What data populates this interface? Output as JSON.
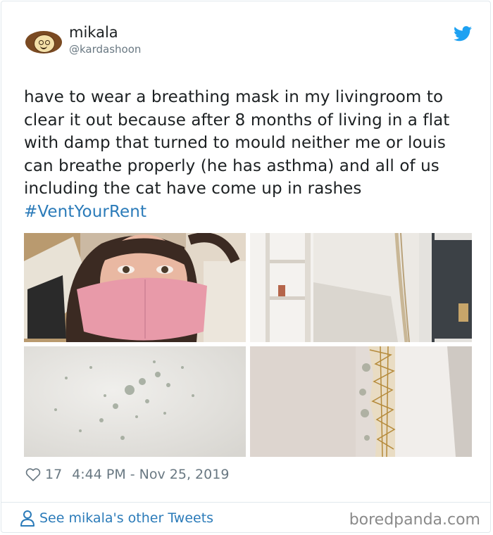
{
  "user": {
    "name": "mikala",
    "handle": "@kardashoon",
    "avatar": "cartoon-face-avatar"
  },
  "tweet": {
    "text": "have to wear a breathing mask in my livingroom to clear it out because after 8 months of living in a flat with damp that turned to mould neither me or louis can breathe properly (he has asthma) and all of us including the cat have come up in rashes",
    "hashtag": "#VentYourRent"
  },
  "media": [
    {
      "name": "selfie-with-pink-mask-photo"
    },
    {
      "name": "mouldy-wall-with-shelves-photo"
    },
    {
      "name": "mould-spots-on-wall-photo"
    },
    {
      "name": "cracked-wall-edge-photo"
    }
  ],
  "meta": {
    "likes": "17",
    "timestamp": "4:44 PM - Nov 25, 2019"
  },
  "footer": {
    "see_more": "See mikala's other Tweets",
    "source": "boredpanda.com"
  },
  "colors": {
    "link": "#2b7bb9",
    "twitter_blue": "#1da1f2",
    "muted": "#697882",
    "border": "#e1e8ed"
  },
  "icons": [
    "twitter-bird-icon",
    "heart-icon",
    "person-icon"
  ]
}
